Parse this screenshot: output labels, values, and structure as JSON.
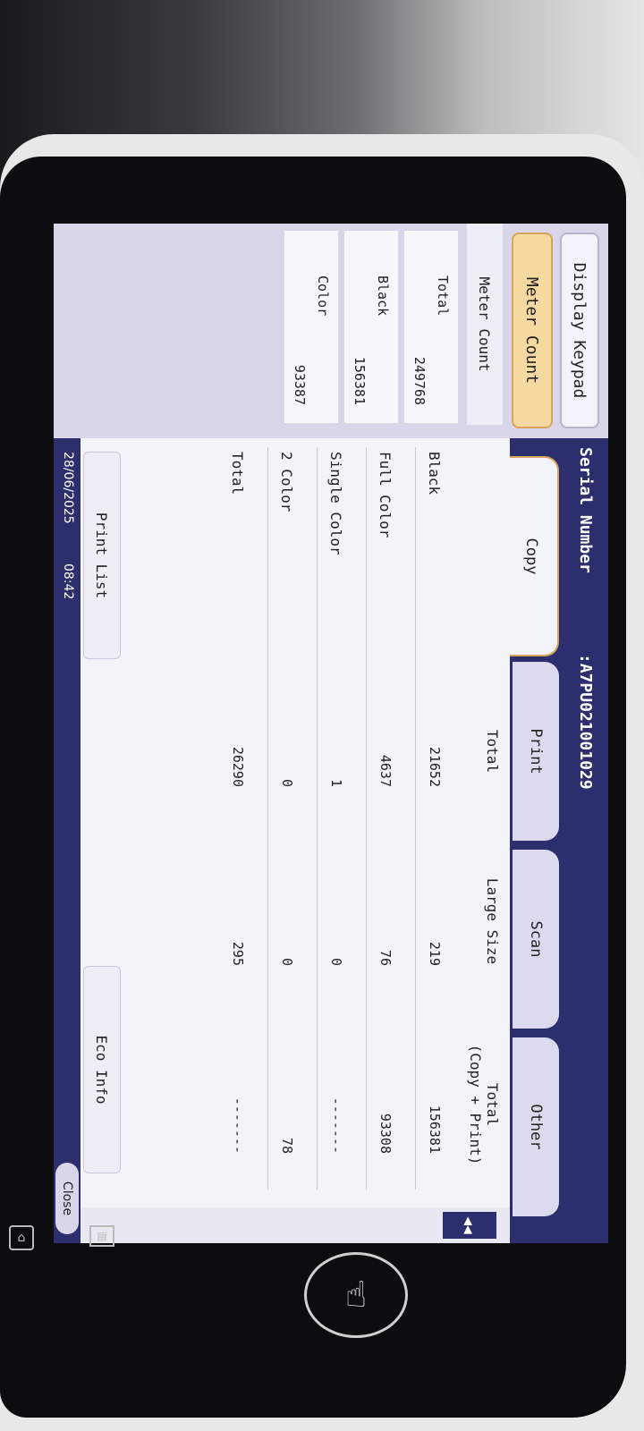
{
  "sidebar": {
    "display_keypad": "Display Keypad",
    "meter_count_tab": "Meter Count",
    "section_title": "Meter Count",
    "items": [
      {
        "label": "Total",
        "value": "249768"
      },
      {
        "label": "Black",
        "value": "156381"
      },
      {
        "label": "Color",
        "value": "93387"
      }
    ]
  },
  "header": {
    "label": "Serial Number",
    "value": ":A7PU021001029"
  },
  "tabs": [
    "Copy",
    "Print",
    "Scan",
    "Other"
  ],
  "table": {
    "columns": [
      "Total",
      "Large Size",
      "Total\n(Copy + Print)"
    ],
    "rows": [
      {
        "label": "Black",
        "total": "21652",
        "large": "219",
        "copy_print": "156381"
      },
      {
        "label": "Full Color",
        "total": "4637",
        "large": "76",
        "copy_print": "93308"
      },
      {
        "label": "Single Color",
        "total": "1",
        "large": "0",
        "copy_print": "-------"
      },
      {
        "label": "2 Color",
        "total": "0",
        "large": "0",
        "copy_print": "78"
      },
      {
        "label": "Total",
        "total": "26290",
        "large": "295",
        "copy_print": "-------"
      }
    ]
  },
  "buttons": {
    "print_list": "Print List",
    "eco_info": "Eco Info",
    "close": "Close",
    "scroll": "◀◀"
  },
  "status": {
    "date": "28/06/2025",
    "time": "08:42"
  },
  "hardware": {
    "home_icon": "home-icon",
    "panel_icon": "panel-icon",
    "touch_icon": "touch-icon"
  }
}
